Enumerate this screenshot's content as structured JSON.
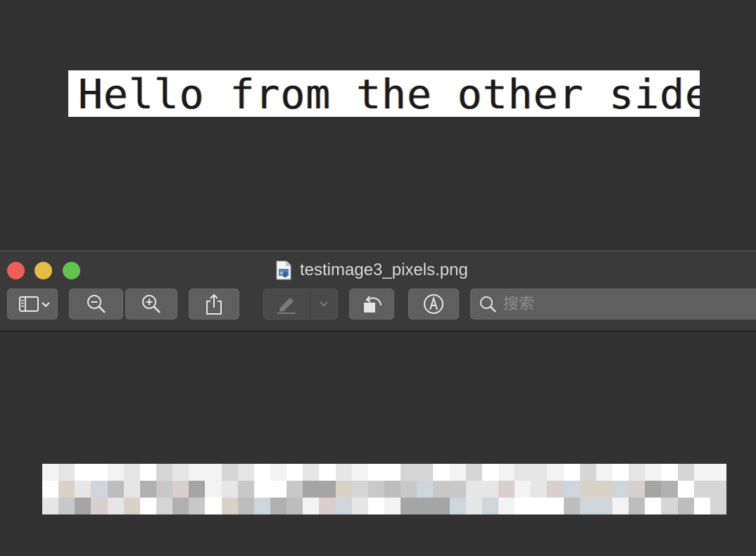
{
  "top_image": {
    "text": "Hello from the other side"
  },
  "window": {
    "title": "testimage3_pixels.png",
    "traffic_lights": {
      "close": "#ec5f57",
      "minimize": "#e3bd43",
      "zoom": "#62c44d"
    }
  },
  "toolbar": {
    "sidebar_button": {
      "icon": "sidebar-icon",
      "dropdown_icon": "chevron-down-icon"
    },
    "zoom_out_button": {
      "icon": "zoom-out-icon"
    },
    "zoom_in_button": {
      "icon": "zoom-in-icon"
    },
    "share_button": {
      "icon": "share-icon"
    },
    "highlight_button": {
      "icon": "highlighter-icon",
      "dropdown_icon": "chevron-down-icon",
      "enabled": false
    },
    "rotate_button": {
      "icon": "rotate-left-icon"
    },
    "markup_button": {
      "icon": "markup-pen-icon"
    },
    "search": {
      "placeholder": "搜索",
      "value": "",
      "icon": "search-icon"
    }
  },
  "colors": {
    "background": "#323232",
    "titlebar": "#3a3a3a",
    "button": "#5f5f5f"
  }
}
